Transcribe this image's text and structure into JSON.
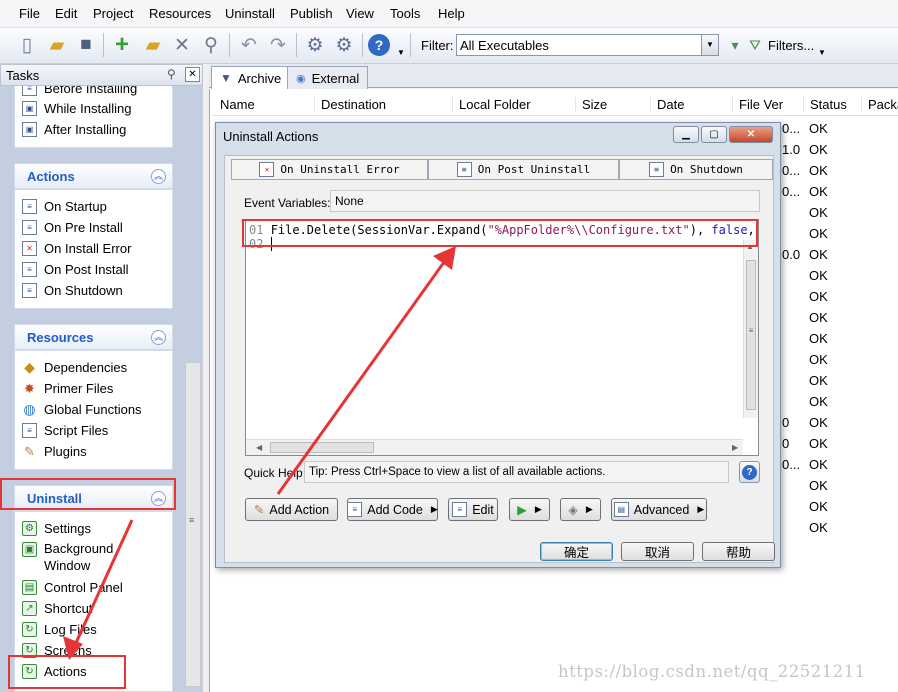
{
  "menu": [
    "File",
    "Edit",
    "Project",
    "Resources",
    "Uninstall",
    "Publish",
    "View",
    "Tools",
    "Help"
  ],
  "toolbar": {
    "filter_label": "Filter:",
    "filter_value": "All Executables",
    "filters_button": "Filters..."
  },
  "tasks": {
    "title": "Tasks",
    "partial_group": [
      "Before Installing",
      "While Installing",
      "After Installing"
    ],
    "groups": [
      {
        "title": "Actions",
        "items": [
          "On Startup",
          "On Pre Install",
          "On Install Error",
          "On Post Install",
          "On Shutdown"
        ]
      },
      {
        "title": "Resources",
        "items": [
          "Dependencies",
          "Primer Files",
          "Global Functions",
          "Script Files",
          "Plugins"
        ]
      },
      {
        "title": "Uninstall",
        "items": [
          "Settings",
          "Background Window",
          "Control Panel",
          "Shortcut",
          "Log Files",
          "Screens",
          "Actions"
        ]
      }
    ]
  },
  "tabs": [
    "Archive",
    "External"
  ],
  "columns": [
    "Name",
    "Destination",
    "Local Folder",
    "Size",
    "Date",
    "File Ver",
    "Status",
    "Packa"
  ],
  "status_values": [
    "OK",
    "OK",
    "OK",
    "OK",
    "OK",
    "OK",
    "OK",
    "OK",
    "OK",
    "OK",
    "OK",
    "OK",
    "OK",
    "OK",
    "OK",
    "OK",
    "OK",
    "OK",
    "OK",
    "OK"
  ],
  "fragments": [
    "0...",
    "1.0",
    "0...",
    "0...",
    "0.0",
    "0",
    "0",
    "0..."
  ],
  "dialog": {
    "title": "Uninstall Actions",
    "tabs": [
      "On Uninstall Error",
      "On Post Uninstall",
      "On Shutdown"
    ],
    "event_vars_label": "Event Variables:",
    "event_vars_value": "None",
    "code": {
      "line1_no": "01",
      "line1_pre": "File.Delete(SessionVar.Expand(",
      "line1_str": "\"%AppFolder%\\\\Configure.txt\"",
      "line1_mid": "), ",
      "line1_kw": "false",
      "line1_end": ",",
      "line2_no": "02"
    },
    "quick_help_label": "Quick Help:",
    "quick_help_text": "Tip: Press Ctrl+Space to view a list of all available actions.",
    "buttons": {
      "add_action": "Add Action",
      "add_code": "Add Code",
      "edit": "Edit",
      "advanced": "Advanced"
    },
    "ok": "确定",
    "cancel": "取消",
    "help": "帮助"
  },
  "watermark": "https://blog.csdn.net/qq_22521211"
}
